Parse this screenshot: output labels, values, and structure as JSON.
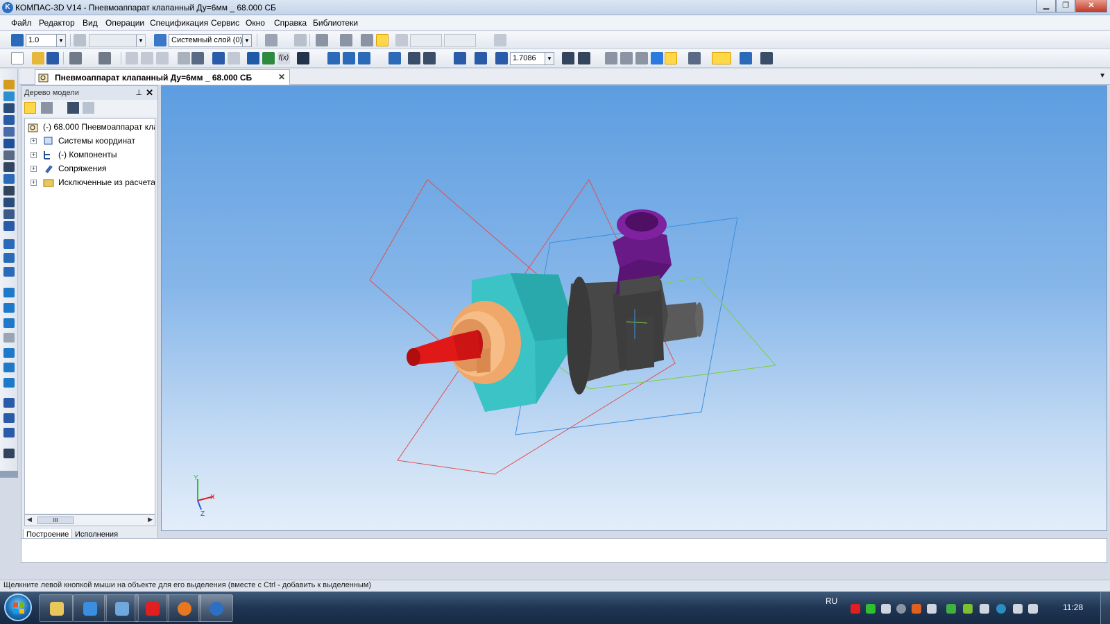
{
  "window": {
    "title": "КОМПАС-3D V14 - Пневмоаппарат клапанный Ду=6мм _ 68.000 СБ",
    "logo_letter": "K",
    "minimize": "▁",
    "maximize": "❐",
    "close": "✕"
  },
  "menu": [
    "Файл",
    "Редактор",
    "Вид",
    "Операции",
    "Спецификация",
    "Сервис",
    "Окно",
    "Справка",
    "Библиотеки"
  ],
  "toolbar1": {
    "step_value": "1.0",
    "layer_value": "Системный слой (0)"
  },
  "toolbar2": {
    "zoom_value": "1.7086"
  },
  "document_tab": {
    "label": "Пневмоаппарат клапанный Ду=6мм _ 68.000 СБ",
    "close": "✕"
  },
  "model_tree": {
    "title": "Дерево модели",
    "pin": "⊥",
    "close": "✕",
    "root": "(-) 68.000 Пневмоаппарат кла",
    "items": [
      {
        "label": "Системы координат",
        "expander": "+"
      },
      {
        "label": "(-) Компоненты",
        "expander": "+"
      },
      {
        "label": "Сопряжения",
        "expander": "+"
      },
      {
        "label": "Исключенные из расчета",
        "expander": "+"
      }
    ],
    "scroll_thumb": "III",
    "tabs": [
      "Построение",
      "Исполнения"
    ]
  },
  "axes": {
    "x": "X",
    "y": "Y",
    "z": "Z"
  },
  "command_line": "",
  "status_text": "Щелкните левой кнопкой мыши на объекте для его выделения (вместе с Ctrl - добавить к выделенным)",
  "taskbar": {
    "language": "RU",
    "clock": "11:28"
  },
  "colors": {
    "viewport_top": "#5d9de0",
    "viewport_bottom": "#e4eefa",
    "body_cyan": "#3fc6c8",
    "nut_orange": "#f0a86a",
    "fitting_red": "#e01818",
    "nut_purple": "#7a1a9a",
    "housing_gray": "#505050"
  }
}
